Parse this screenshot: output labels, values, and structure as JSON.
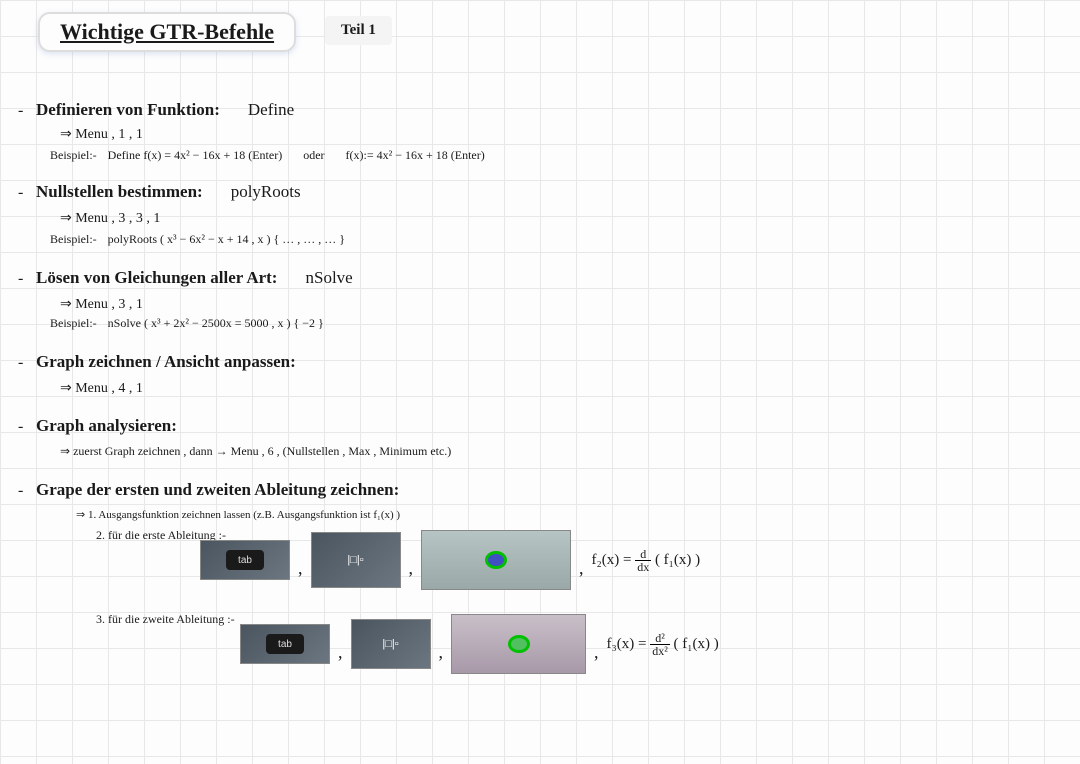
{
  "title": "Wichtige GTR-Befehle",
  "part": "Teil 1",
  "s1": {
    "title": "Definieren von Funktion:",
    "cmd": "Define",
    "menu": "Menu , 1 , 1",
    "exLabel": "Beispiel:-",
    "ex1": "Define  f(x) = 4x² − 16x + 18  (Enter)",
    "oder": "oder",
    "ex2": "f(x):=  4x² − 16x + 18  (Enter)"
  },
  "s2": {
    "title": "Nullstellen bestimmen:",
    "cmd": "polyRoots",
    "menu": "Menu , 3 , 3 , 1",
    "exLabel": "Beispiel:-",
    "ex": "polyRoots ( x³ − 6x² − x + 14 , x )     { … , … , … }"
  },
  "s3": {
    "title": "Lösen von Gleichungen aller Art:",
    "cmd": "nSolve",
    "menu": "Menu , 3 , 1",
    "exLabel": "Beispiel:-",
    "ex": "nSolve ( x³ + 2x² − 2500x = 5000 , x )     { −2 }"
  },
  "s4": {
    "title": "Graph zeichnen / Ansicht anpassen:",
    "menu": "Menu , 4 , 1"
  },
  "s5": {
    "title": "Graph analysieren:",
    "menu": "zuerst Graph zeichnen , dann → Menu , 6 , (Nullstellen , Max , Minimum etc.)"
  },
  "s6": {
    "title": "Grape der ersten und zweiten Ableitung zeichnen:",
    "step1": "1. Ausgangsfunktion zeichnen lassen  (z.B. Ausgangsfunktion  ist  f₁(x) )",
    "step2": "2. für die erste Ableitung :-",
    "step3": "3. für die zweite Ableitung :-",
    "tab": "tab",
    "f2a": "f₂(x) =",
    "f2b": "( f₁(x) )",
    "f3a": "f₃(x) =",
    "f3b": "( f₁(x) )",
    "d1top": "d",
    "d1bot": "dx",
    "d2top": "d²",
    "d2bot": "dx²"
  }
}
